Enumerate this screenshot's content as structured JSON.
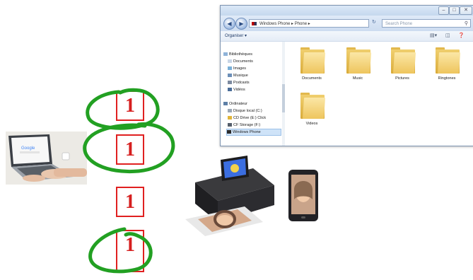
{
  "explorer": {
    "address": "Windows Phone ▸ Phone ▸",
    "search_placeholder": "Search Phone",
    "toolbar": {
      "organize_label": "Organiser ▾"
    },
    "nav": {
      "libraries": "Bibliothèques",
      "documents": "Documents",
      "images": "Images",
      "music": "Musique",
      "podcasts": "Podcasts",
      "videos": "Vidéos",
      "computer": "Ordinateur",
      "local_disk": "Disque local (C:)",
      "cd_drive": "CD Drive (E:) Click",
      "cf_storage": "CF Storage (F:)",
      "windows_phone": "Windows Phone"
    },
    "folders": [
      "Documents",
      "Music",
      "Pictures",
      "Ringtones",
      "Videos"
    ]
  },
  "numbers": [
    "1",
    "1",
    "1",
    "1"
  ],
  "colors": {
    "red": "#d61f1f",
    "green": "#22a022",
    "folder": "#eec55d"
  }
}
